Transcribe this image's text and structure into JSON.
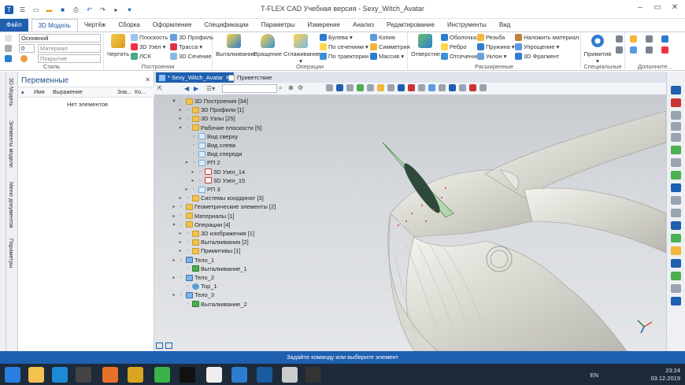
{
  "app": {
    "title": "T-FLEX CAD Учебная версия - Sexy_Witch_Avatar"
  },
  "ribbon": {
    "tabs": [
      "Файл",
      "3D Модель",
      "Чертёж",
      "Сборка",
      "Оформление",
      "Спецификации",
      "Параметры",
      "Измерение",
      "Анализ",
      "Редактирование",
      "Инструменты",
      "Вид"
    ],
    "active_tab": "3D Модель",
    "style": {
      "label": "Стиль",
      "combo1": "Основной",
      "combo2_num": "0",
      "combo2": "Материал",
      "combo3": "Покрытие"
    },
    "build": {
      "label": "Построения",
      "draw": "Чертить",
      "plane": "Плоскость",
      "node3d": "3D Узел",
      "lsk": "ЛСК",
      "profile3d": "3D Профиль",
      "path": "Трасса",
      "section3d": "3D Сечение"
    },
    "ops": {
      "label": "Операции",
      "extrude": "Выталкивание",
      "rotate": "Вращение",
      "smooth": "Сглаживание",
      "boolean": "Булева",
      "by_sections": "По сечениям",
      "by_path": "По траектории",
      "copy": "Копия",
      "symmetry": "Симметрия",
      "array": "Массив"
    },
    "ext": {
      "label": "Расширенные",
      "hole": "Отверстие",
      "shell": "Оболочка",
      "rib": "Ребро",
      "cut": "Отсечение",
      "thread": "Резьба",
      "spring": "Пружина",
      "slope": "Уклон",
      "apply_material": "Наложить материал",
      "simplify": "Упрощение",
      "fragment3d": "3D Фрагмент"
    },
    "special": {
      "label": "Специальные",
      "primitive": "Примитив"
    },
    "extra": {
      "label": "Дополнитe..."
    }
  },
  "left_tabs": [
    "3D Модель",
    "Элементы модели",
    "Меню документов",
    "Параметры"
  ],
  "variables": {
    "title": "Переменные",
    "columns": [
      "Имя",
      "Выражение",
      "Зна...",
      "Ко..."
    ],
    "empty": "Нет элементов"
  },
  "doc_tabs": [
    {
      "label": "* Sexy_Witch_Avatar"
    },
    {
      "label": "Приветствие"
    }
  ],
  "tree": [
    {
      "label": "3D Построения [34]",
      "depth": 0,
      "icon": "folder",
      "exp": "▼"
    },
    {
      "label": "3D Профили [1]",
      "depth": 1,
      "icon": "folder",
      "exp": "▸"
    },
    {
      "label": "3D Узлы [25]",
      "depth": 1,
      "icon": "folder",
      "exp": "▸"
    },
    {
      "label": "Рабочие плоскости [5]",
      "depth": 1,
      "icon": "folder",
      "exp": "▾"
    },
    {
      "label": "Вид сверху",
      "depth": 2,
      "icon": "plane",
      "exp": ""
    },
    {
      "label": "Вид слева",
      "depth": 2,
      "icon": "plane",
      "exp": ""
    },
    {
      "label": "Вид спереди",
      "depth": 2,
      "icon": "plane",
      "exp": ""
    },
    {
      "label": "РП 2",
      "depth": 2,
      "icon": "plane",
      "exp": "▾"
    },
    {
      "label": "3D Узел_14",
      "depth": 3,
      "icon": "node",
      "exp": "▸"
    },
    {
      "label": "3D Узел_15",
      "depth": 3,
      "icon": "node",
      "exp": "▸"
    },
    {
      "label": "РП 3",
      "depth": 2,
      "icon": "plane",
      "exp": "▸"
    },
    {
      "label": "Системы координат [3]",
      "depth": 1,
      "icon": "folder",
      "exp": "▸"
    },
    {
      "label": "Геометрические элементы [2]",
      "depth": 0,
      "icon": "folder",
      "exp": "▸"
    },
    {
      "label": "Материалы [1]",
      "depth": 0,
      "icon": "folder",
      "exp": "▸"
    },
    {
      "label": "Операции [4]",
      "depth": 0,
      "icon": "folder",
      "exp": "▾"
    },
    {
      "label": "3D изображения [1]",
      "depth": 1,
      "icon": "folder",
      "exp": "▸"
    },
    {
      "label": "Выталкивания [2]",
      "depth": 1,
      "icon": "folder",
      "exp": "▸"
    },
    {
      "label": "Примитивы [1]",
      "depth": 1,
      "icon": "folder",
      "exp": "▸"
    },
    {
      "label": "Тело_1",
      "depth": 0,
      "icon": "body",
      "exp": "▸"
    },
    {
      "label": "Выталкивание_1",
      "depth": 1,
      "icon": "ext",
      "exp": ""
    },
    {
      "label": "Тело_2",
      "depth": 0,
      "icon": "body",
      "exp": "▸"
    },
    {
      "label": "Тор_1",
      "depth": 1,
      "icon": "torus",
      "exp": ""
    },
    {
      "label": "Тело_3",
      "depth": 0,
      "icon": "body",
      "exp": "▸"
    },
    {
      "label": "Выталкивание_2",
      "depth": 1,
      "icon": "ext",
      "exp": ""
    }
  ],
  "status": {
    "text": "Задайте команду или выберите элемент"
  },
  "taskbar": {
    "lang": "EN",
    "time": "23:24",
    "date": "03.12.2019"
  }
}
